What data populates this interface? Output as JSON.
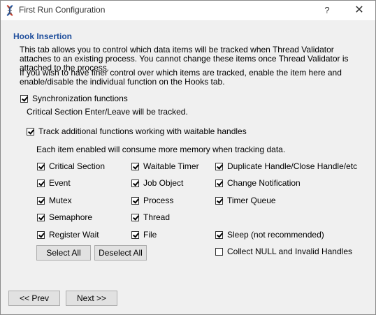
{
  "window": {
    "title": "First Run Configuration",
    "help_label": "?",
    "close_label": "✕"
  },
  "hook": {
    "section_title": "Hook Insertion",
    "intro": "This tab allows you to control which data items will be tracked when Thread Validator attaches to an existing process. You cannot change these items once Thread Validator is attached to the process.",
    "finer": "If you wish to have finer control over which items are tracked, enable the item here and enable/disable the individual function on the Hooks tab.",
    "sync_label": "Synchronization functions",
    "sync_desc": "Critical Section Enter/Leave will be tracked.",
    "track_label": "Track additional functions working with waitable handles",
    "memory_note": "Each item enabled will consume more memory when tracking data."
  },
  "items": {
    "critical_section": "Critical Section",
    "event": "Event",
    "mutex": "Mutex",
    "semaphore": "Semaphore",
    "register_wait": "Register Wait",
    "waitable_timer": "Waitable Timer",
    "job_object": "Job Object",
    "process": "Process",
    "thread": "Thread",
    "file": "File",
    "duplicate_handle": "Duplicate Handle/Close Handle/etc",
    "change_notification": "Change Notification",
    "timer_queue": "Timer Queue",
    "sleep": "Sleep (not recommended)",
    "collect_null": "Collect NULL and Invalid Handles"
  },
  "buttons": {
    "select_all": "Select All",
    "deselect_all": "Deselect All",
    "prev": "<< Prev",
    "next": "Next >>"
  }
}
